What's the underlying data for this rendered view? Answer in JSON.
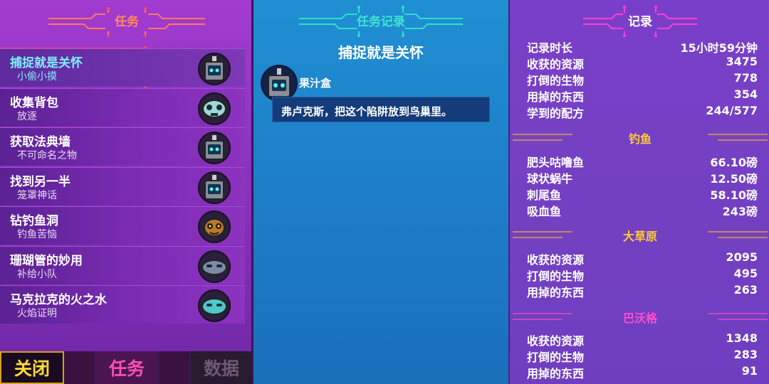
{
  "left": {
    "header_title": "任务",
    "quests": [
      {
        "title": "捕捉就是关怀",
        "subtitle": "小偷小摸",
        "icon": "juicebox-robot-icon",
        "selected": true
      },
      {
        "title": "收集背包",
        "subtitle": "放逐",
        "icon": "skull-creature-icon",
        "selected": false
      },
      {
        "title": "获取法典墙",
        "subtitle": "不可命名之物",
        "icon": "juicebox-robot-icon",
        "selected": false
      },
      {
        "title": "找到另一半",
        "subtitle": "笼罩神话",
        "icon": "juicebox-robot-icon",
        "selected": false
      },
      {
        "title": "钻钓鱼洞",
        "subtitle": "钓鱼苦恼",
        "icon": "dog-creature-icon",
        "selected": false
      },
      {
        "title": "珊瑚管的妙用",
        "subtitle": "补给小队",
        "icon": "slug-creature-icon",
        "selected": false
      },
      {
        "title": "马克拉克的火之水",
        "subtitle": "火焰证明",
        "icon": "teal-slug-icon",
        "selected": false
      }
    ],
    "bottom_tabs": {
      "close": "关闭",
      "quests": "任务",
      "data": "数据"
    }
  },
  "middle": {
    "header_title": "任务记录",
    "quest_title": "捕捉就是关怀",
    "npc_name": "果汁盒",
    "dialog_text": "弗卢克斯，把这个陷阱放到鸟巢里。"
  },
  "right": {
    "header_title": "记录",
    "general": [
      {
        "label": "记录时长",
        "value": "15小时59分钟"
      },
      {
        "label": "收获的资源",
        "value": "3475"
      },
      {
        "label": "打倒的生物",
        "value": "778"
      },
      {
        "label": "用掉的东西",
        "value": "354"
      },
      {
        "label": "学到的配方",
        "value": "244/577"
      }
    ],
    "fishing_title": "钓鱼",
    "fishing": [
      {
        "label": "肥头咕噜鱼",
        "value": "66.10磅"
      },
      {
        "label": "球状蜗牛",
        "value": "12.50磅"
      },
      {
        "label": "刺尾鱼",
        "value": "58.10磅"
      },
      {
        "label": "吸血鱼",
        "value": "243磅"
      }
    ],
    "savanna_title": "大草原",
    "savanna": [
      {
        "label": "收获的资源",
        "value": "2095"
      },
      {
        "label": "打倒的生物",
        "value": "495"
      },
      {
        "label": "用掉的东西",
        "value": "263"
      }
    ],
    "bawg_title": "巴沃格",
    "bawg": [
      {
        "label": "收获的资源",
        "value": "1348"
      },
      {
        "label": "打倒的生物",
        "value": "283"
      },
      {
        "label": "用掉的东西",
        "value": "91"
      }
    ]
  },
  "colors": {
    "left_header": "#ff8a5c",
    "middle_header": "#3fe3d0",
    "selected_text": "#7ef0ff",
    "fishing_header": "#ffcc33",
    "savanna_header": "#ffcc33",
    "bawg_header": "#ff4fd0",
    "close_tab": "#ffdd33",
    "quests_tab": "#ff4fb2"
  }
}
